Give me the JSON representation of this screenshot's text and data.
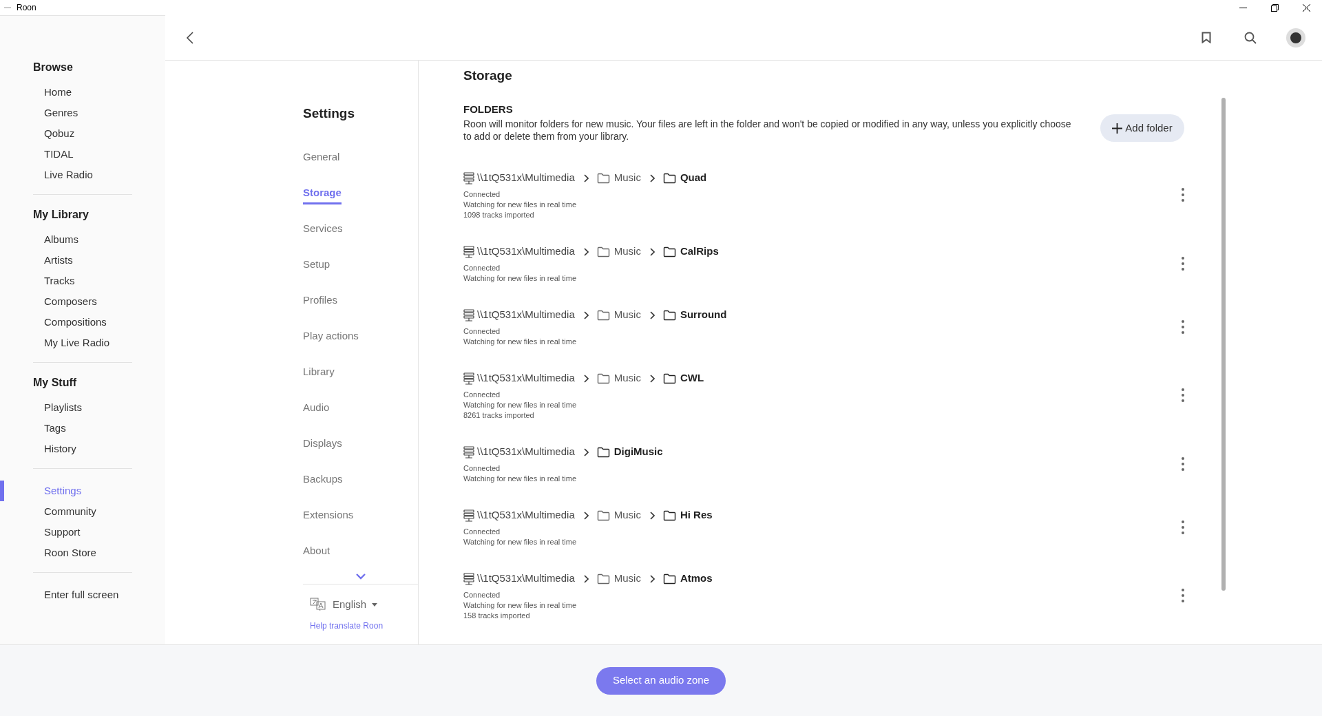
{
  "window": {
    "title": "Roon"
  },
  "sidebar": {
    "groups": [
      {
        "heading": "Browse",
        "items": [
          {
            "label": "Home",
            "selected": false
          },
          {
            "label": "Genres",
            "selected": false
          },
          {
            "label": "Qobuz",
            "selected": false
          },
          {
            "label": "TIDAL",
            "selected": false
          },
          {
            "label": "Live Radio",
            "selected": false
          }
        ]
      },
      {
        "heading": "My Library",
        "items": [
          {
            "label": "Albums",
            "selected": false
          },
          {
            "label": "Artists",
            "selected": false
          },
          {
            "label": "Tracks",
            "selected": false
          },
          {
            "label": "Composers",
            "selected": false
          },
          {
            "label": "Compositions",
            "selected": false
          },
          {
            "label": "My Live Radio",
            "selected": false
          }
        ]
      },
      {
        "heading": "My Stuff",
        "items": [
          {
            "label": "Playlists",
            "selected": false
          },
          {
            "label": "Tags",
            "selected": false
          },
          {
            "label": "History",
            "selected": false
          }
        ]
      },
      {
        "items": [
          {
            "label": "Settings",
            "selected": true
          },
          {
            "label": "Community",
            "selected": false
          },
          {
            "label": "Support",
            "selected": false
          },
          {
            "label": "Roon Store",
            "selected": false
          }
        ]
      },
      {
        "items": [
          {
            "label": "Enter full screen",
            "selected": false
          }
        ]
      }
    ]
  },
  "settings_nav": {
    "title": "Settings",
    "items": [
      {
        "label": "General",
        "selected": false
      },
      {
        "label": "Storage",
        "selected": true
      },
      {
        "label": "Services",
        "selected": false
      },
      {
        "label": "Setup",
        "selected": false
      },
      {
        "label": "Profiles",
        "selected": false
      },
      {
        "label": "Play actions",
        "selected": false
      },
      {
        "label": "Library",
        "selected": false
      },
      {
        "label": "Audio",
        "selected": false
      },
      {
        "label": "Displays",
        "selected": false
      },
      {
        "label": "Backups",
        "selected": false
      },
      {
        "label": "Extensions",
        "selected": false
      },
      {
        "label": "About",
        "selected": false
      }
    ],
    "language": "English",
    "translate_link": "Help translate Roon"
  },
  "content": {
    "title": "Storage",
    "section": "FOLDERS",
    "description": "Roon will monitor folders for new music. Your files are left in the folder and won't be copied or modified in any way, unless you explicitly choose to add or delete them from your library.",
    "add_button": "Add folder",
    "folders": [
      {
        "path": [
          {
            "kind": "server",
            "label": "\\\\1tQ531x\\Multimedia"
          },
          {
            "kind": "folder",
            "label": "Music"
          },
          {
            "kind": "current",
            "label": "Quad"
          }
        ],
        "status": [
          "Connected",
          "Watching for new files in real time",
          "1098 tracks imported"
        ]
      },
      {
        "path": [
          {
            "kind": "server",
            "label": "\\\\1tQ531x\\Multimedia"
          },
          {
            "kind": "folder",
            "label": "Music"
          },
          {
            "kind": "current",
            "label": "CalRips"
          }
        ],
        "status": [
          "Connected",
          "Watching for new files in real time"
        ]
      },
      {
        "path": [
          {
            "kind": "server",
            "label": "\\\\1tQ531x\\Multimedia"
          },
          {
            "kind": "folder",
            "label": "Music"
          },
          {
            "kind": "current",
            "label": "Surround"
          }
        ],
        "status": [
          "Connected",
          "Watching for new files in real time"
        ]
      },
      {
        "path": [
          {
            "kind": "server",
            "label": "\\\\1tQ531x\\Multimedia"
          },
          {
            "kind": "folder",
            "label": "Music"
          },
          {
            "kind": "current",
            "label": "CWL"
          }
        ],
        "status": [
          "Connected",
          "Watching for new files in real time",
          "8261 tracks imported"
        ]
      },
      {
        "path": [
          {
            "kind": "server",
            "label": "\\\\1tQ531x\\Multimedia"
          },
          {
            "kind": "current",
            "label": "DigiMusic"
          }
        ],
        "status": [
          "Connected",
          "Watching for new files in real time"
        ]
      },
      {
        "path": [
          {
            "kind": "server",
            "label": "\\\\1tQ531x\\Multimedia"
          },
          {
            "kind": "folder",
            "label": "Music"
          },
          {
            "kind": "current",
            "label": "Hi Res"
          }
        ],
        "status": [
          "Connected",
          "Watching for new files in real time"
        ]
      },
      {
        "path": [
          {
            "kind": "server",
            "label": "\\\\1tQ531x\\Multimedia"
          },
          {
            "kind": "folder",
            "label": "Music"
          },
          {
            "kind": "current",
            "label": "Atmos"
          }
        ],
        "status": [
          "Connected",
          "Watching for new files in real time",
          "158 tracks imported"
        ]
      }
    ]
  },
  "footer": {
    "zone_button": "Select an audio zone"
  }
}
